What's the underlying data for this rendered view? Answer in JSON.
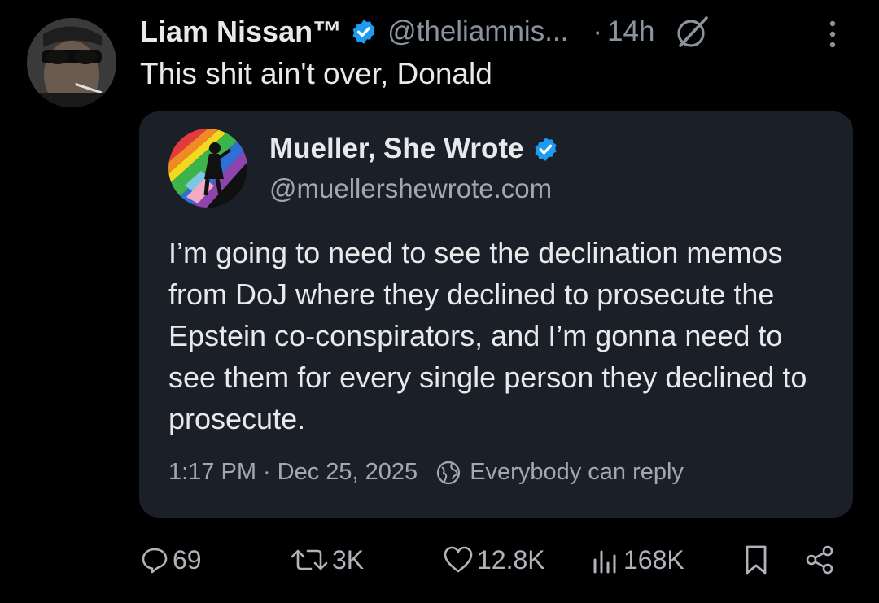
{
  "post": {
    "author": {
      "display_name": "Liam Nissan™",
      "handle": "@theliamnis...",
      "verified": true
    },
    "separator": "·",
    "time": "14h",
    "text": "This shit ain't over, Donald",
    "icons": {
      "avatar": "avatar-photo",
      "verified": "verified-badge-icon",
      "grok": "grok-icon",
      "more": "more-vertical-icon"
    }
  },
  "quote": {
    "author": {
      "display_name": "Mueller, She Wrote",
      "handle": "@muellershewrote.com",
      "verified": true
    },
    "body": "I’m going to need to see the declination memos from DoJ where they declined to prosecute the Epstein co-conspirators, and I’m gonna need to see them for every single person they declined to prosecute.",
    "time": "1:17 PM",
    "separator": "·",
    "date": "Dec 25, 2025",
    "reply_setting": "Everybody can reply"
  },
  "actions": {
    "replies": "69",
    "reposts": "3K",
    "likes": "12.8K",
    "views": "168K"
  },
  "colors": {
    "background": "#000000",
    "card": "#1b1f28",
    "text": "#e7e9ea",
    "muted": "#8b949e",
    "verified": "#1d9bf0"
  }
}
